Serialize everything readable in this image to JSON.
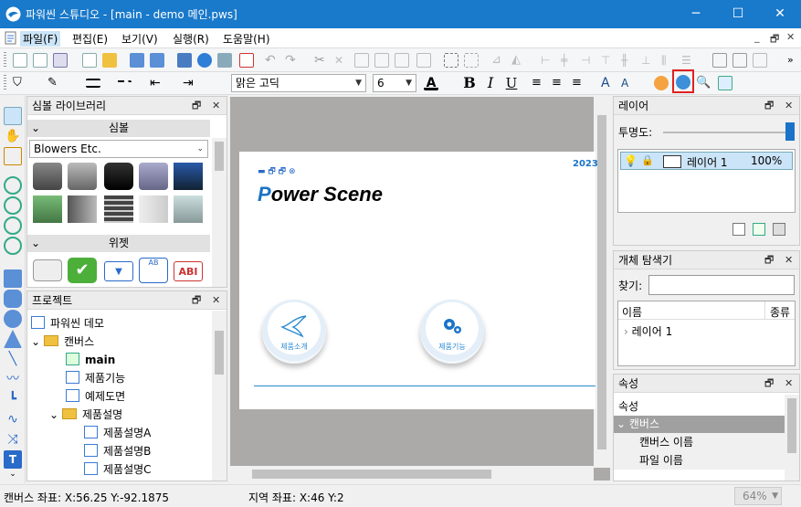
{
  "window": {
    "title": "파워씬 스튜디오 - [main - demo 메인.pws]",
    "minimize": "─",
    "maximize": "☐",
    "close": "✕"
  },
  "menu": [
    "파일(F)",
    "편집(E)",
    "보기(V)",
    "실행(R)",
    "도움말(H)"
  ],
  "mdi_controls": [
    "_",
    "🗗",
    "✕"
  ],
  "format_bar": {
    "font_name": "맑은 고딕",
    "font_size": "6",
    "bold": "B",
    "italic": "I",
    "underline": "U",
    "text_color": "#000000"
  },
  "symbol_library": {
    "title": "심볼 라이브러리",
    "symbol_group": "심볼",
    "category": "Blowers Etc.",
    "widget_group": "위젯"
  },
  "project": {
    "title": "프로젝트",
    "items": [
      {
        "label": "파워씬 데모",
        "level": 0
      },
      {
        "label": "캔버스",
        "level": 1
      },
      {
        "label": "main",
        "level": 2
      },
      {
        "label": "제품기능",
        "level": 2
      },
      {
        "label": "예제도면",
        "level": 2
      },
      {
        "label": "제품설명",
        "level": 2
      },
      {
        "label": "제품설명A",
        "level": 3
      },
      {
        "label": "제품설명B",
        "level": 3
      },
      {
        "label": "제품설명C",
        "level": 3
      }
    ]
  },
  "canvas": {
    "brand": "Power Scene",
    "brand_initial": "P",
    "brand_rest": "ower Scene",
    "year": "2023",
    "buttons": [
      "제품소개",
      "제품기능"
    ]
  },
  "layer_panel": {
    "title": "레이어",
    "opacity_label": "투명도:",
    "layer_name": "레이어 1",
    "layer_opacity": "100%"
  },
  "object_explorer": {
    "title": "개체 탐색기",
    "find_label": "찾기:",
    "col_name": "이름",
    "col_type": "종류",
    "items": [
      "레이어 1"
    ]
  },
  "properties": {
    "title": "속성",
    "label": "속성",
    "group": "캔버스",
    "rows": [
      "캔버스 이름",
      "파일 이름"
    ]
  },
  "status": {
    "canvas_coord": "캔버스 좌표: X:56.25 Y:-92.1875",
    "local_coord": "지역 좌표: X:46 Y:2",
    "zoom": "64%"
  },
  "colors": {
    "titlebar": "#1979ca",
    "accent": "#1a73c8",
    "canvas_bg": "#abaaa9"
  }
}
